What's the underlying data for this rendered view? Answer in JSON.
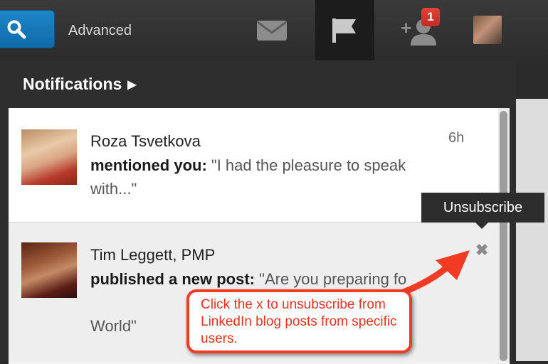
{
  "topbar": {
    "advanced_label": "Advanced",
    "notification_badge": "1",
    "icons": [
      "search-icon",
      "mail-icon",
      "flag-icon",
      "add-connection-icon",
      "avatar"
    ]
  },
  "panel": {
    "title": "Notifications",
    "notifications": [
      {
        "name": "Roza Tsvetkova",
        "action": "mentioned you:",
        "text": " \"I had the pleasure to speak with...\"",
        "time": "6h"
      },
      {
        "name": "Tim Leggett, PMP",
        "action": "published a new post:",
        "text": " \"Are you preparing fo",
        "text_end": "World\""
      }
    ],
    "tooltip": "Unsubscribe",
    "close_glyph": "✖"
  },
  "callout": {
    "text": "Click the x to unsubscribe from LinkedIn blog posts from specific users."
  },
  "colors": {
    "accent_blue": "#0f6aa8",
    "badge_red": "#d0342b",
    "callout_red": "#f33a23"
  }
}
